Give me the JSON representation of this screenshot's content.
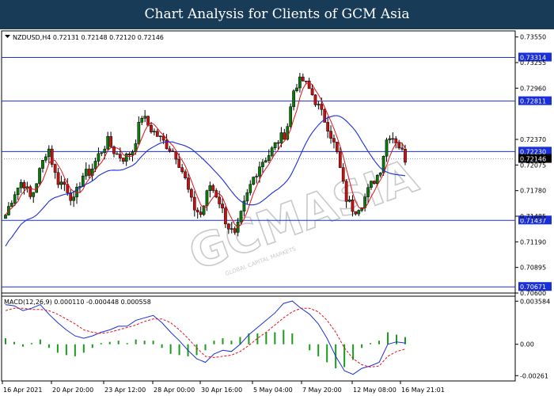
{
  "header": {
    "title": "Chart Analysis for Clients of GCM Asia"
  },
  "symbol_info": "NZDUSD,H4  0.72131 0.72148 0.72120 0.72146",
  "macd_info": "MACD(12,26,9) 0.000110 -0.000448 0.000558",
  "watermark": "GCMASIA",
  "watermark_sub": "GLOBAL CAPITAL MARKETS",
  "colors": {
    "banner": "#183b58",
    "bull_candle": "#0a7a0a",
    "bear_candle": "#cc1010",
    "ma_fast": "#e0101a",
    "ma_slow": "#1a2fd8",
    "level_line": "#1a2fd8",
    "macd_hist": "#1b9b1b",
    "macd_line": "#1a2fd8",
    "signal_line": "#e0101a",
    "current_price_label": "#000000"
  },
  "chart_data": {
    "type": "candlestick",
    "instrument": "NZDUSD",
    "timeframe": "H4",
    "price_axis": {
      "ticks": [
        "0.73550",
        "0.73255",
        "0.72960",
        "0.72370",
        "0.72075",
        "0.71780",
        "0.71485",
        "0.71190",
        "0.70895",
        "0.70600"
      ],
      "range": [
        0.706,
        0.7362
      ]
    },
    "levels": [
      {
        "label": "0.73314",
        "value": 0.73314
      },
      {
        "label": "0.72811",
        "value": 0.72811
      },
      {
        "label": "0.72230",
        "value": 0.7223
      },
      {
        "label": "0.71437",
        "value": 0.71437
      },
      {
        "label": "0.70671",
        "value": 0.70671
      }
    ],
    "current_price": {
      "label": "0.72146",
      "value": 0.72146
    },
    "time_axis": [
      "16 Apr 2021",
      "20 Apr 20:00",
      "23 Apr 12:00",
      "28 Apr 00:00",
      "30 Apr 16:00",
      "5 May 04:00",
      "7 May 20:00",
      "12 May 08:00",
      "16 May 21:01"
    ],
    "close_path": [
      0.715,
      0.7175,
      0.719,
      0.7168,
      0.72,
      0.723,
      0.719,
      0.7185,
      0.7165,
      0.7195,
      0.72,
      0.722,
      0.7235,
      0.722,
      0.7215,
      0.7225,
      0.7265,
      0.725,
      0.724,
      0.723,
      0.722,
      0.7195,
      0.716,
      0.715,
      0.7185,
      0.717,
      0.714,
      0.7125,
      0.716,
      0.719,
      0.721,
      0.722,
      0.7235,
      0.7245,
      0.73,
      0.7305,
      0.729,
      0.727,
      0.725,
      0.722,
      0.717,
      0.7155,
      0.7165,
      0.7185,
      0.72,
      0.7245,
      0.7235,
      0.7215
    ],
    "macd": {
      "axis_ticks": [
        "0.003584",
        "0.00",
        "-0.00261"
      ],
      "range": [
        -0.00305,
        0.004
      ],
      "macd_line": [
        0.0033,
        0.0032,
        0.0028,
        0.003,
        0.0033,
        0.0025,
        0.0018,
        0.0012,
        0.0007,
        0.0005,
        0.0007,
        0.001,
        0.0012,
        0.0015,
        0.0015,
        0.002,
        0.0022,
        0.0024,
        0.0018,
        0.001,
        0.0003,
        -0.0005,
        -0.0012,
        -0.0015,
        -0.0008,
        -0.0005,
        -0.0006,
        0.0,
        0.0008,
        0.0014,
        0.002,
        0.0026,
        0.0034,
        0.0036,
        0.003,
        0.0025,
        0.0017,
        0.0005,
        -0.001,
        -0.0022,
        -0.0025,
        -0.002,
        -0.0018,
        -0.0015,
        0.0,
        0.0002,
        0.0001
      ],
      "signal_line": [
        0.0028,
        0.003,
        0.003,
        0.0029,
        0.0029,
        0.0028,
        0.0025,
        0.0021,
        0.0017,
        0.0012,
        0.001,
        0.0009,
        0.001,
        0.0012,
        0.0014,
        0.0016,
        0.0019,
        0.0021,
        0.0021,
        0.0018,
        0.0012,
        0.0005,
        -0.0003,
        -0.001,
        -0.0011,
        -0.001,
        -0.0009,
        -0.0006,
        -0.0001,
        0.0005,
        0.001,
        0.0016,
        0.0022,
        0.0027,
        0.003,
        0.003,
        0.0027,
        0.002,
        0.001,
        -0.0003,
        -0.0012,
        -0.0017,
        -0.0019,
        -0.0018,
        -0.001,
        -0.0006,
        -0.0004
      ],
      "histogram": [
        0.0005,
        0.0002,
        -0.0002,
        0.0001,
        0.0004,
        -0.0003,
        -0.0007,
        -0.0009,
        -0.001,
        -0.0007,
        -0.0003,
        0.0001,
        0.0002,
        0.0003,
        0.0001,
        0.0004,
        0.0003,
        0.0003,
        -0.0003,
        -0.0008,
        -0.0009,
        -0.001,
        -0.0009,
        -0.0005,
        0.0003,
        0.0005,
        0.0003,
        0.0006,
        0.0009,
        0.0009,
        0.001,
        0.001,
        0.0012,
        0.0009,
        0.0,
        -0.0005,
        -0.001,
        -0.0015,
        -0.002,
        -0.0019,
        -0.0013,
        -0.0003,
        0.0001,
        0.0003,
        0.001,
        0.0008,
        0.0006
      ]
    }
  }
}
